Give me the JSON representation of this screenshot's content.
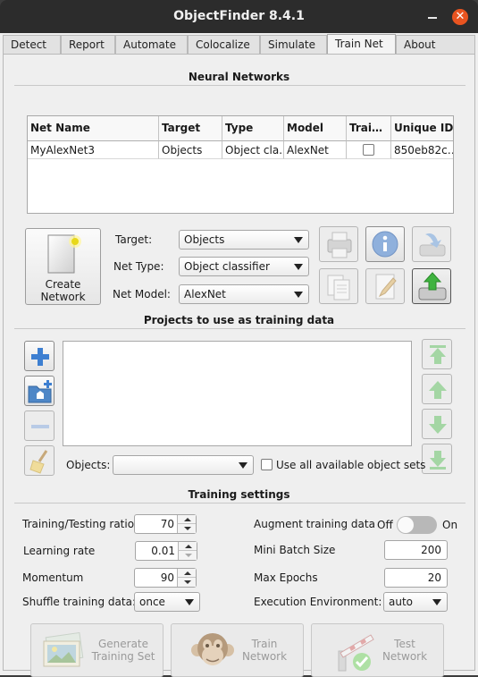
{
  "window": {
    "title": "ObjectFinder 8.4.1"
  },
  "tabs": [
    {
      "label": "Detect"
    },
    {
      "label": "Report"
    },
    {
      "label": "Automate"
    },
    {
      "label": "Colocalize"
    },
    {
      "label": "Simulate"
    },
    {
      "label": "Train Net",
      "active": true
    },
    {
      "label": "About"
    }
  ],
  "neural_networks": {
    "title": "Neural Networks",
    "columns": [
      "Net Name",
      "Target",
      "Type",
      "Model",
      "Trai…",
      "Unique ID"
    ],
    "rows": [
      {
        "net_name": "MyAlexNet3",
        "target": "Objects",
        "type": "Object cla…",
        "model": "AlexNet",
        "trained": false,
        "unique_id": "850eb82c…"
      }
    ]
  },
  "create": {
    "label_line1": "Create",
    "label_line2": "Network",
    "target_label": "Target:",
    "target_value": "Objects",
    "net_type_label": "Net Type:",
    "net_type_value": "Object classifier",
    "net_model_label": "Net Model:",
    "net_model_value": "AlexNet"
  },
  "projects": {
    "title": "Projects to use as training data",
    "objects_label": "Objects:",
    "objects_value": "",
    "use_all_label": "Use all available object sets"
  },
  "training": {
    "title": "Training settings",
    "ratio_label": "Training/Testing ratio",
    "ratio_value": "70",
    "lr_label": "Learning rate",
    "lr_value": "0.01",
    "momentum_label": "Momentum",
    "momentum_value": "90",
    "shuffle_label": "Shuffle training data:",
    "shuffle_value": "once",
    "augment_label": "Augment training data",
    "augment_off": "Off",
    "augment_on": "On",
    "augment_enabled": false,
    "batch_label": "Mini Batch Size",
    "batch_value": "200",
    "epochs_label": "Max Epochs",
    "epochs_value": "20",
    "env_label": "Execution Environment:",
    "env_value": "auto"
  },
  "actions": {
    "generate_l1": "Generate",
    "generate_l2": "Training Set",
    "train_l1": "Train",
    "train_l2": "Network",
    "test_l1": "Test",
    "test_l2": "Network"
  },
  "colors": {
    "accent": "#e95420",
    "titlebar": "#2c2c2c",
    "panel": "#efefef",
    "icon_blue": "#3d7fd1",
    "icon_green": "#3fb33f"
  },
  "icons": [
    "document-new-icon",
    "printer-icon",
    "info-icon",
    "import-icon",
    "copy-icon",
    "edit-icon",
    "upload-drive-icon",
    "plus-icon",
    "add-folder-icon",
    "minus-icon",
    "broom-icon",
    "move-top-icon",
    "move-up-icon",
    "move-down-icon",
    "move-bottom-icon",
    "image-set-icon",
    "monkey-icon",
    "test-barrier-icon"
  ]
}
